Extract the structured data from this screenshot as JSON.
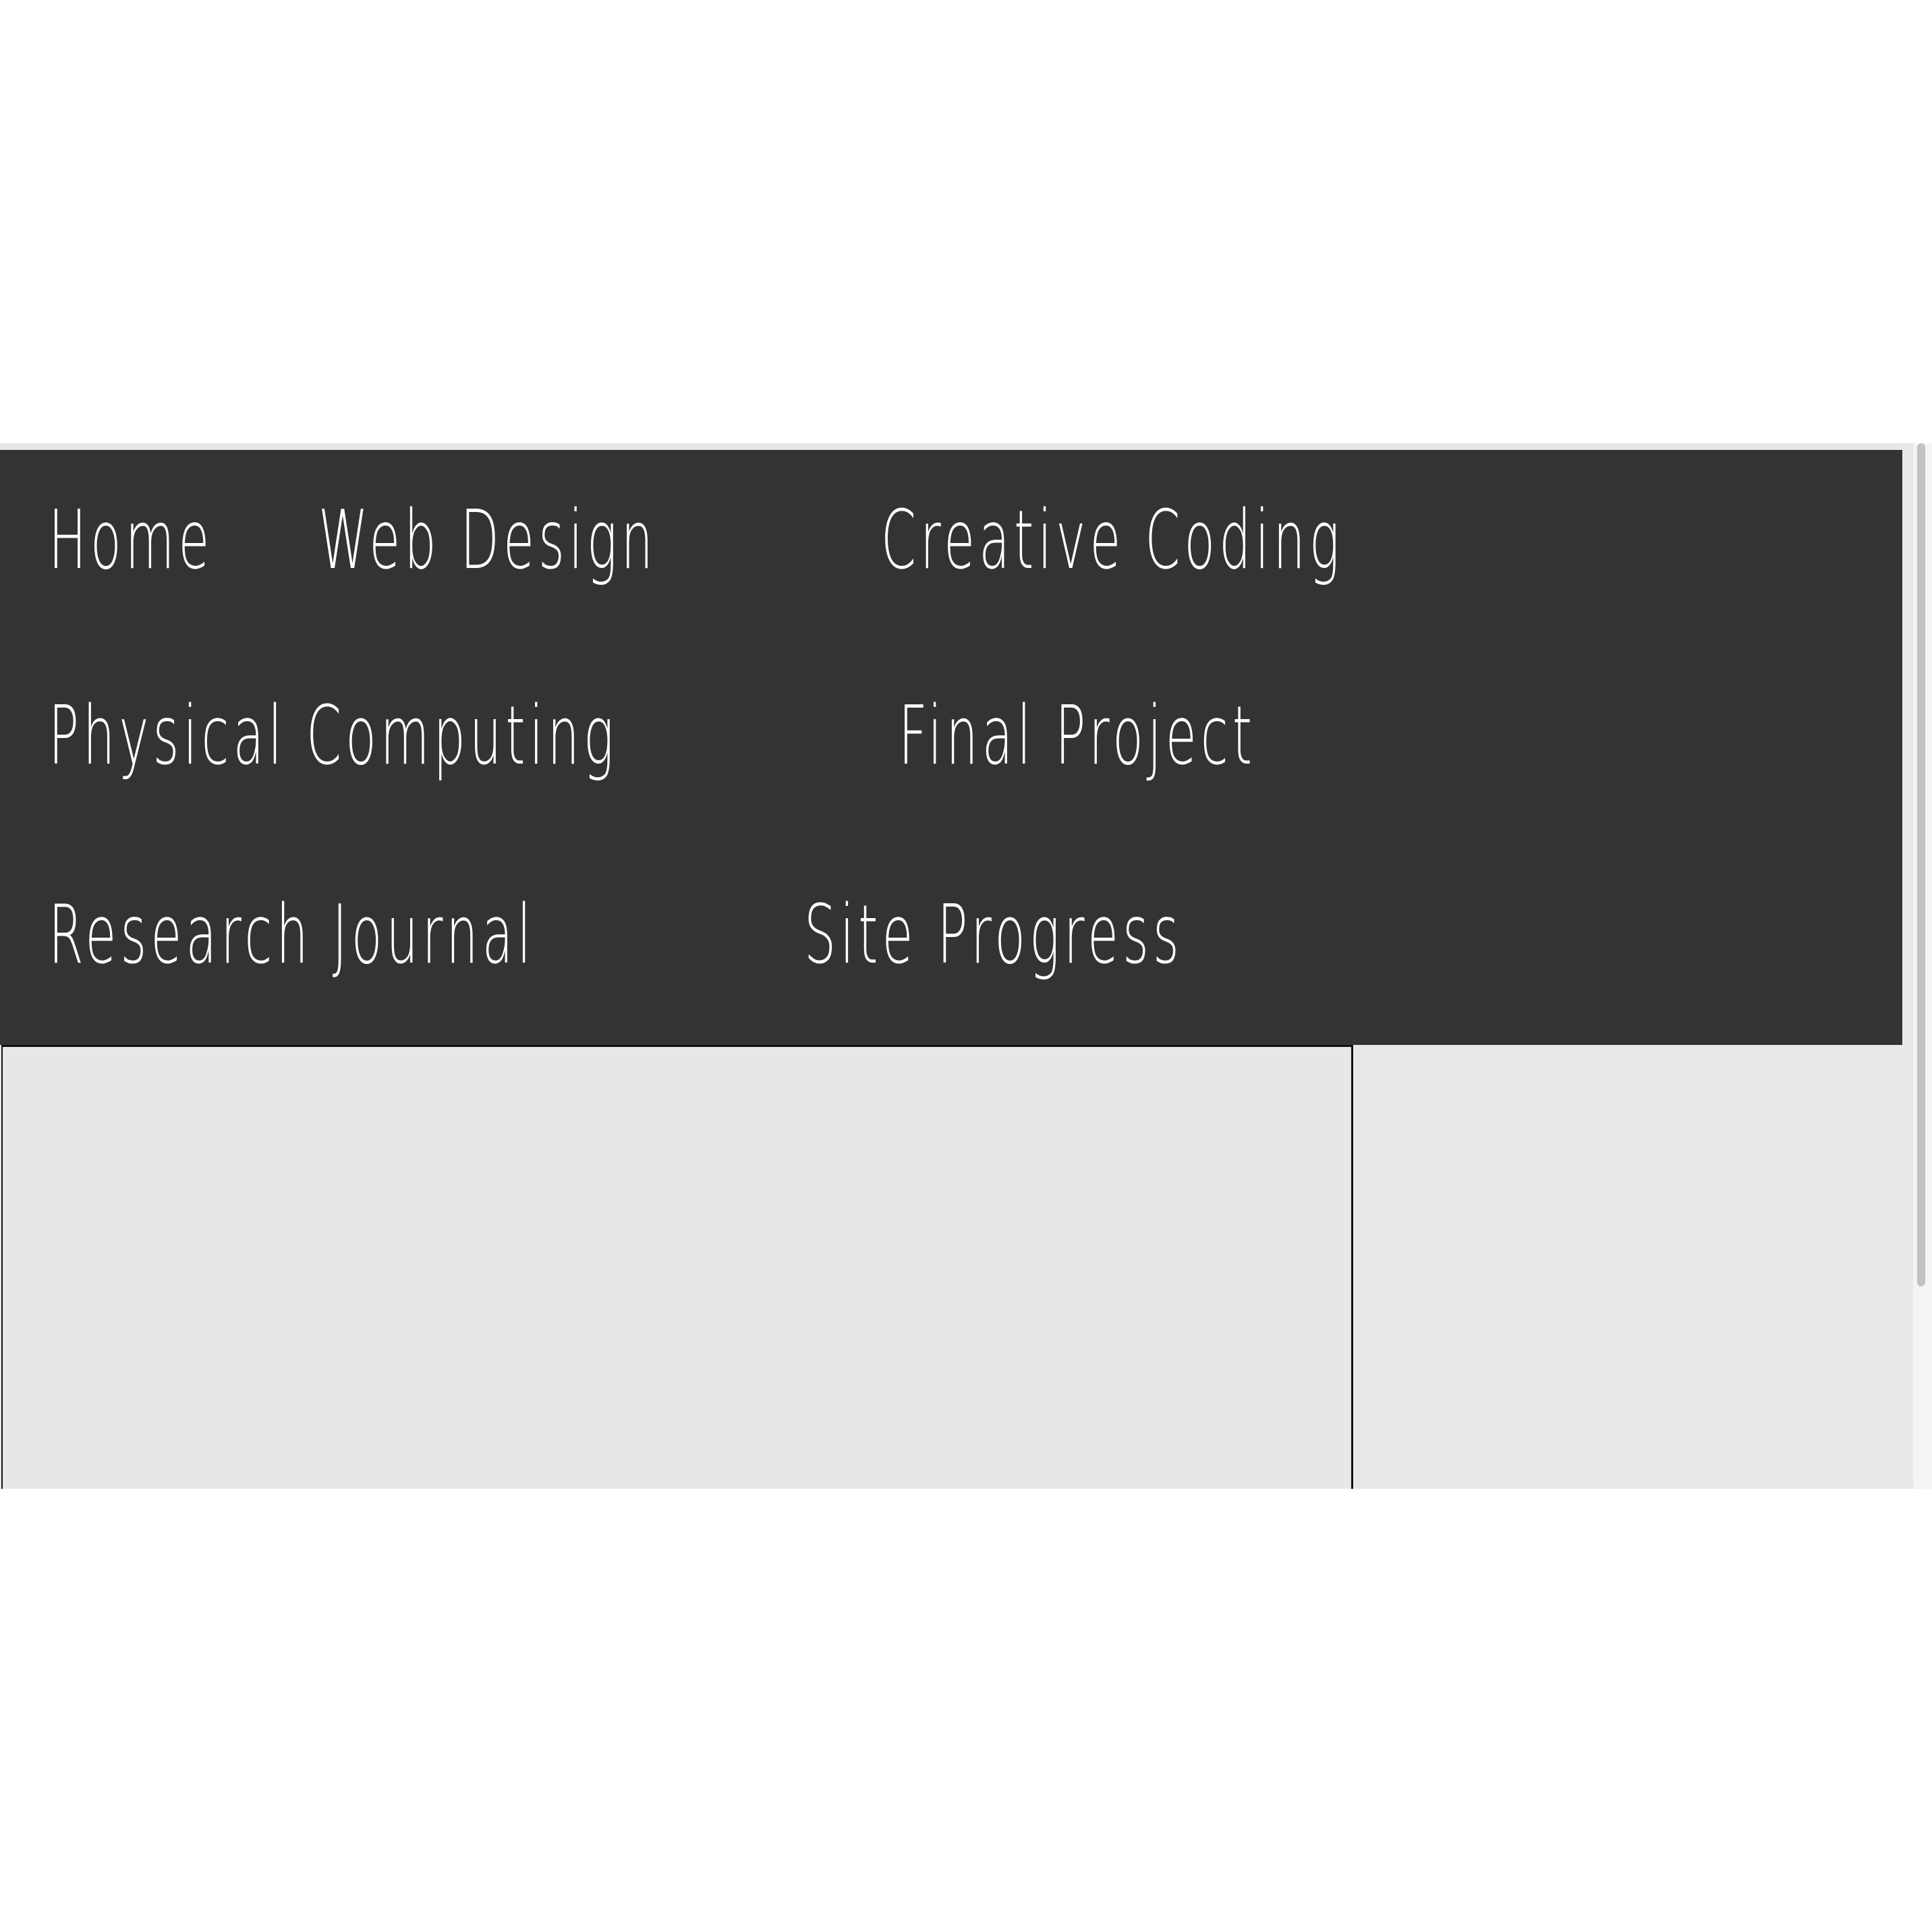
{
  "nav": {
    "items": [
      {
        "label": "Home"
      },
      {
        "label": "Web Design"
      },
      {
        "label": "Creative Coding"
      },
      {
        "label": "Physical Computing"
      },
      {
        "label": "Final Project"
      },
      {
        "label": "Research Journal"
      },
      {
        "label": "Site Progress"
      }
    ]
  },
  "colors": {
    "nav_background": "#333333",
    "nav_text": "#ffffff",
    "page_background": "#e8e8ea"
  }
}
